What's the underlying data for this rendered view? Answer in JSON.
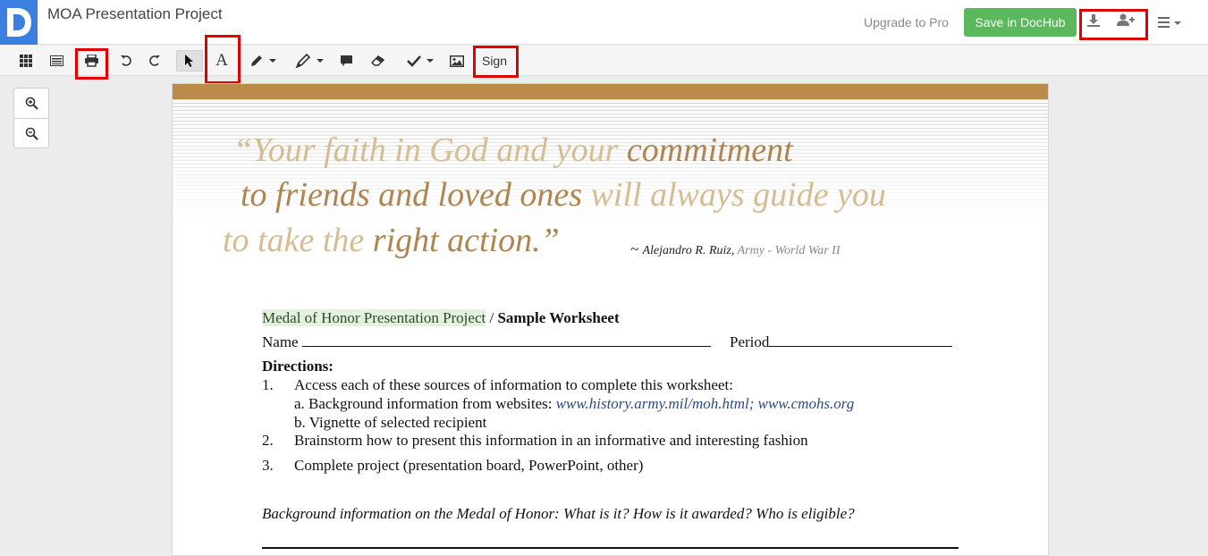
{
  "header": {
    "title": "MOA Presentation Project",
    "upgrade_label": "Upgrade to Pro",
    "save_label": "Save in DocHub",
    "icons": [
      "download-icon",
      "add-user-icon",
      "menu-icon"
    ]
  },
  "toolbar": {
    "sign_label": "Sign",
    "tools": [
      "apps-grid-icon",
      "page-list-icon",
      "print-icon",
      "undo-icon",
      "redo-icon",
      "select-cursor-icon",
      "text-tool-icon",
      "pen-icon",
      "highlighter-icon",
      "comment-icon",
      "eraser-icon",
      "checkmark-icon",
      "image-icon"
    ],
    "text_tool_glyph": "A"
  },
  "zoom": {
    "icons": [
      "zoom-in-icon",
      "zoom-out-icon"
    ]
  },
  "document": {
    "quote": {
      "line1_light": "“Your faith in God and your ",
      "line1_dark": "commitment",
      "line2_dark": "to friends and loved ones ",
      "line2_light": "will always guide you",
      "line3_light": "to take the ",
      "line3_dark": "right action.”",
      "attribution_prefix": "~ ",
      "attribution_name": "Alejandro R. Ruiz, ",
      "attribution_detail": "Army - World War II"
    },
    "worksheet_title_highlight": "Medal of Honor Presentation Project",
    "worksheet_title_rest": " / ",
    "worksheet_title_bold": "Sample Worksheet",
    "name_label": "Name",
    "period_label": "Period",
    "directions_label": "Directions:",
    "items": [
      {
        "num": "1.",
        "text": "Access each of these sources of information to complete this worksheet:"
      },
      {
        "num": "2.",
        "text": "Brainstorm how to present this information in an informative and interesting fashion"
      },
      {
        "num": "3.",
        "text": "Complete project (presentation board, PowerPoint, other)"
      }
    ],
    "sub_a": "a.  Background information from websites:  ",
    "sub_a_link": "www.history.army.mil/moh.html; www.cmohs.org",
    "sub_b": "b.  Vignette of selected recipient",
    "question": "Background information on the Medal of Honor:  What is it?  How is it awarded?  Who is eligible?"
  },
  "colors": {
    "brand_blue": "#3b7fe0",
    "save_green": "#5cb85c",
    "highlight_red": "#e00000",
    "gold_bar": "#bb8b4a",
    "quote_light": "#d6bc92",
    "quote_dark": "#b08450"
  }
}
